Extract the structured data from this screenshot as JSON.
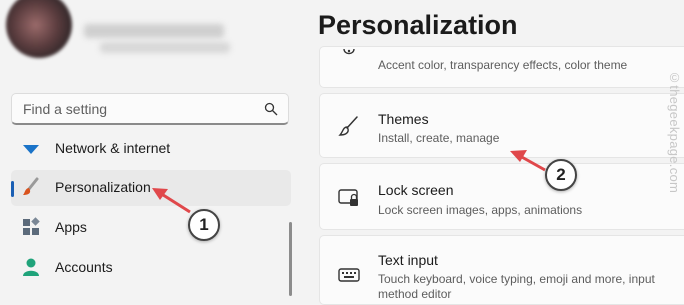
{
  "search": {
    "placeholder": "Find a setting"
  },
  "sidebar": {
    "items": [
      {
        "label": "Network & internet"
      },
      {
        "label": "Personalization"
      },
      {
        "label": "Apps"
      },
      {
        "label": "Accounts"
      }
    ]
  },
  "main": {
    "title": "Personalization",
    "cards": [
      {
        "subtitle": "Accent color, transparency effects, color theme"
      },
      {
        "title": "Themes",
        "subtitle": "Install, create, manage"
      },
      {
        "title": "Lock screen",
        "subtitle": "Lock screen images, apps, animations"
      },
      {
        "title": "Text input",
        "subtitle": "Touch keyboard, voice typing, emoji and more, input method editor"
      }
    ]
  },
  "annotations": {
    "step1": "1",
    "step2": "2"
  },
  "watermark": "©thegeekpage.com",
  "colors": {
    "accent": "#1a5fb4",
    "arrow": "#e0484b"
  }
}
